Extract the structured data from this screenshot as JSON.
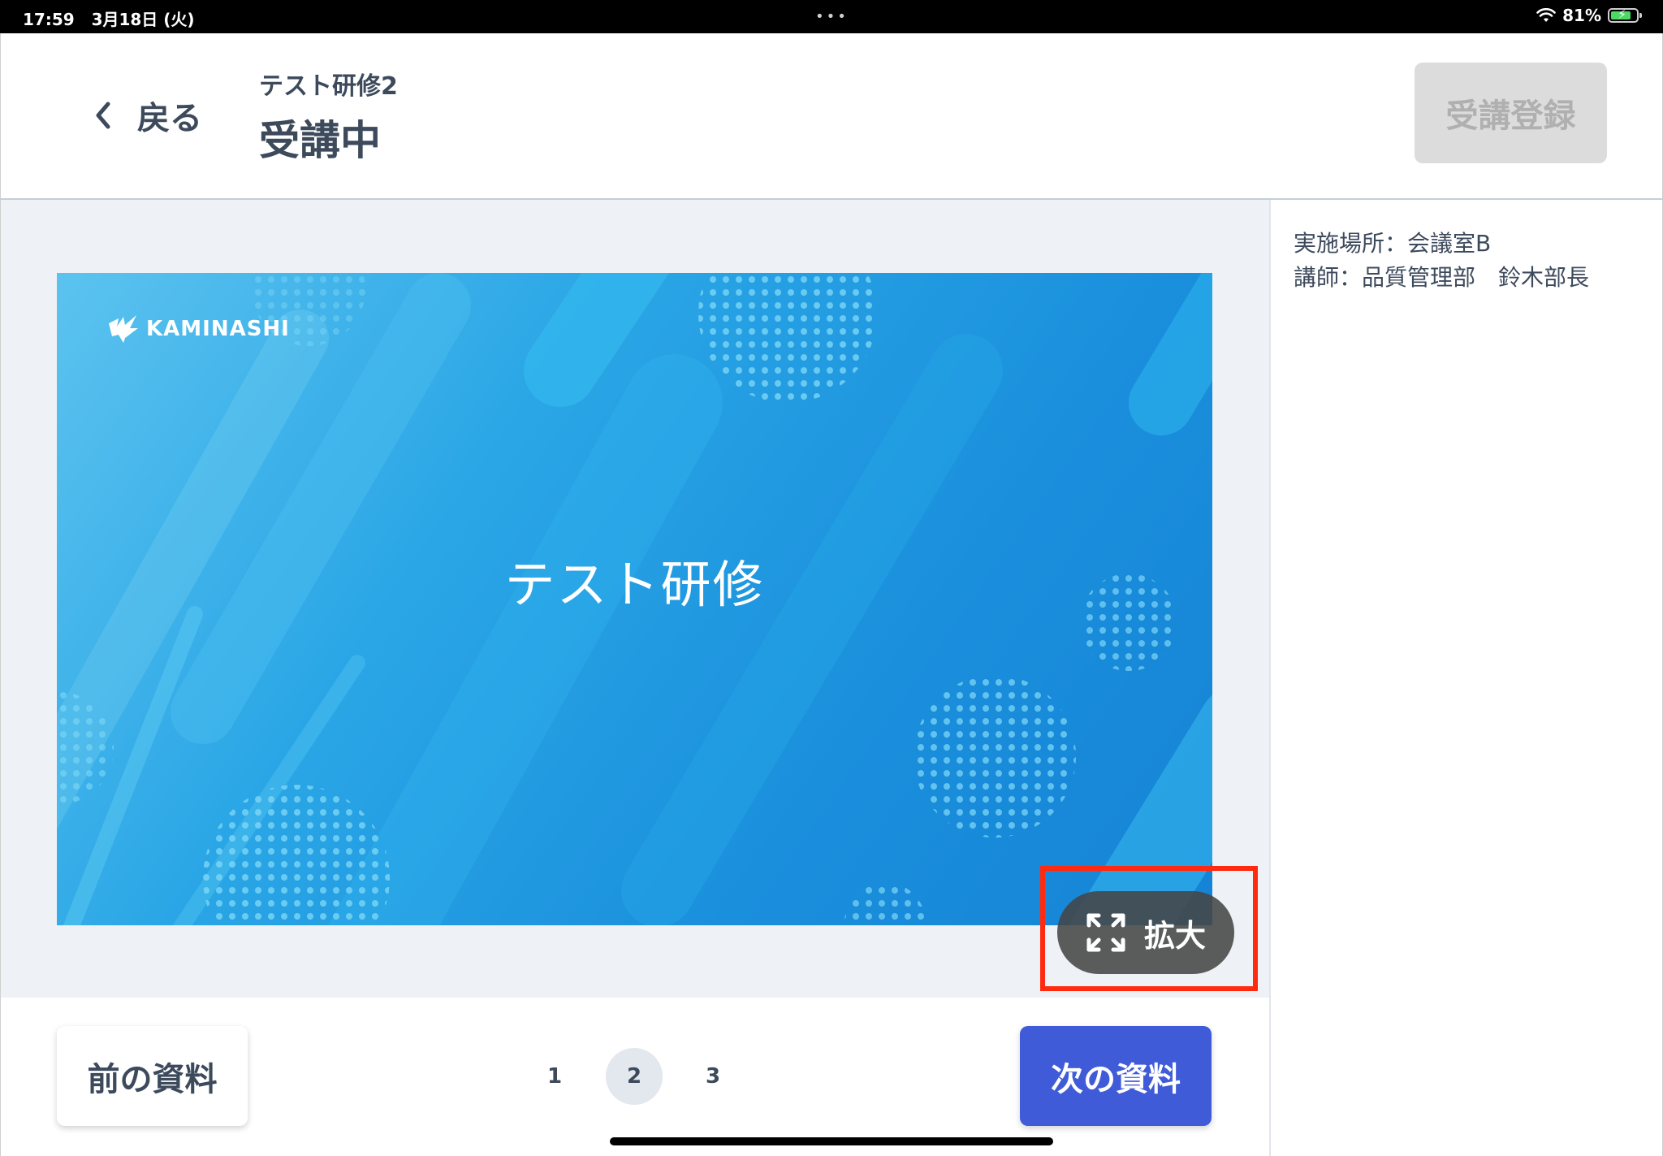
{
  "status_bar": {
    "time": "17:59",
    "date": "3月18日 (火)",
    "dots": "•••",
    "battery": "81%",
    "battery_level": 0.81
  },
  "header": {
    "back_label": "戻る",
    "course_name": "テスト研修2",
    "status": "受講中",
    "register_label": "受講登録"
  },
  "slide": {
    "logo_text": "KAMINASHI",
    "title": "テスト研修"
  },
  "info": {
    "location": "実施場所：会議室B",
    "instructor": "講師：品質管理部　鈴木部長"
  },
  "expand": {
    "label": "拡大"
  },
  "nav": {
    "prev_label": "前の資料",
    "next_label": "次の資料",
    "pages": [
      "1",
      "2",
      "3"
    ],
    "current_page": "2"
  },
  "colors": {
    "primary": "#3f5bd8",
    "highlight": "#ff2a0f",
    "slide_blue": "#1a8fdc",
    "text": "#3d4a5c"
  }
}
